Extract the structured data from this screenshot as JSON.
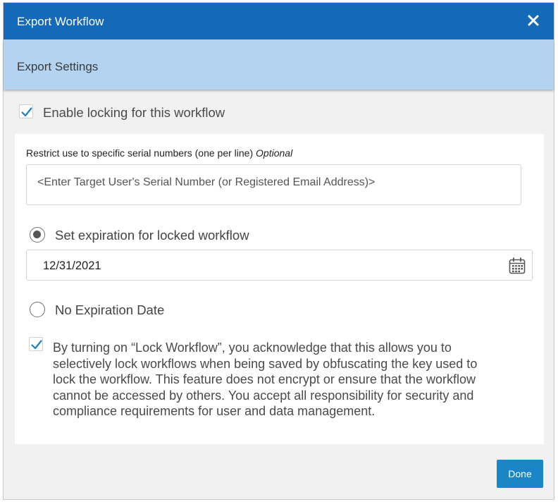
{
  "dialog": {
    "title": "Export Workflow",
    "close_icon": "close-x-icon"
  },
  "subheader": {
    "label": "Export Settings"
  },
  "enable_locking": {
    "checked": true,
    "label": "Enable locking for this workflow"
  },
  "restrict": {
    "label": "Restrict use to specific serial numbers (one per line)",
    "optional_label": "Optional",
    "placeholder": "<Enter Target User's Serial Number (or Registered Email Address)>"
  },
  "expiration": {
    "set_label": "Set expiration for locked workflow",
    "set_selected": true,
    "date_value": "12/31/2021",
    "calendar_icon": "calendar-icon",
    "none_label": "No Expiration Date",
    "none_selected": false
  },
  "acknowledge": {
    "checked": true,
    "text": "By turning on “Lock Workflow”, you acknowledge that this allows you to selectively lock workflows when being saved by obfuscating the key used to lock the workflow. This feature does not encrypt or ensure that the workflow cannot be accessed by others. You accept all responsibility for security and compliance requirements for user and data management."
  },
  "footer": {
    "done_label": "Done"
  },
  "colors": {
    "titlebar": "#1469b8",
    "subheader": "#b3d3f1",
    "checkmark": "#1a7fc4",
    "done_button": "#1a86c7"
  }
}
